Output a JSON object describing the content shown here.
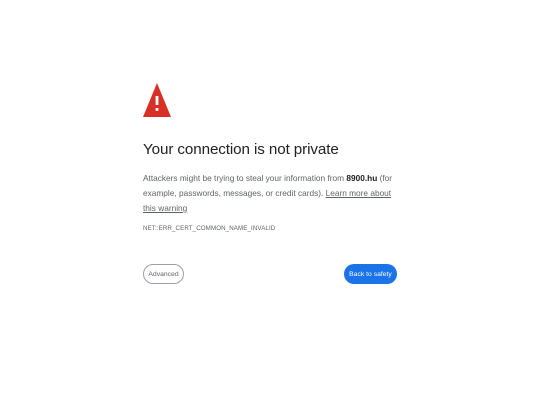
{
  "icon": {
    "name": "warning-triangle-icon",
    "color": "#d93025"
  },
  "heading": "Your connection is not private",
  "message": {
    "part1": "Attackers might be trying to steal your information from ",
    "domain": "8900.hu",
    "part2": " (for example, passwords, messages, or credit cards). ",
    "link_text": "Learn more about this warning"
  },
  "error_code": "NET::ERR_CERT_COMMON_NAME_INVALID",
  "buttons": {
    "advanced_label": "Advanced",
    "back_label": "Back to safety"
  },
  "colors": {
    "primary": "#1a73e8",
    "text": "#202124",
    "secondary_text": "#5f6368"
  }
}
